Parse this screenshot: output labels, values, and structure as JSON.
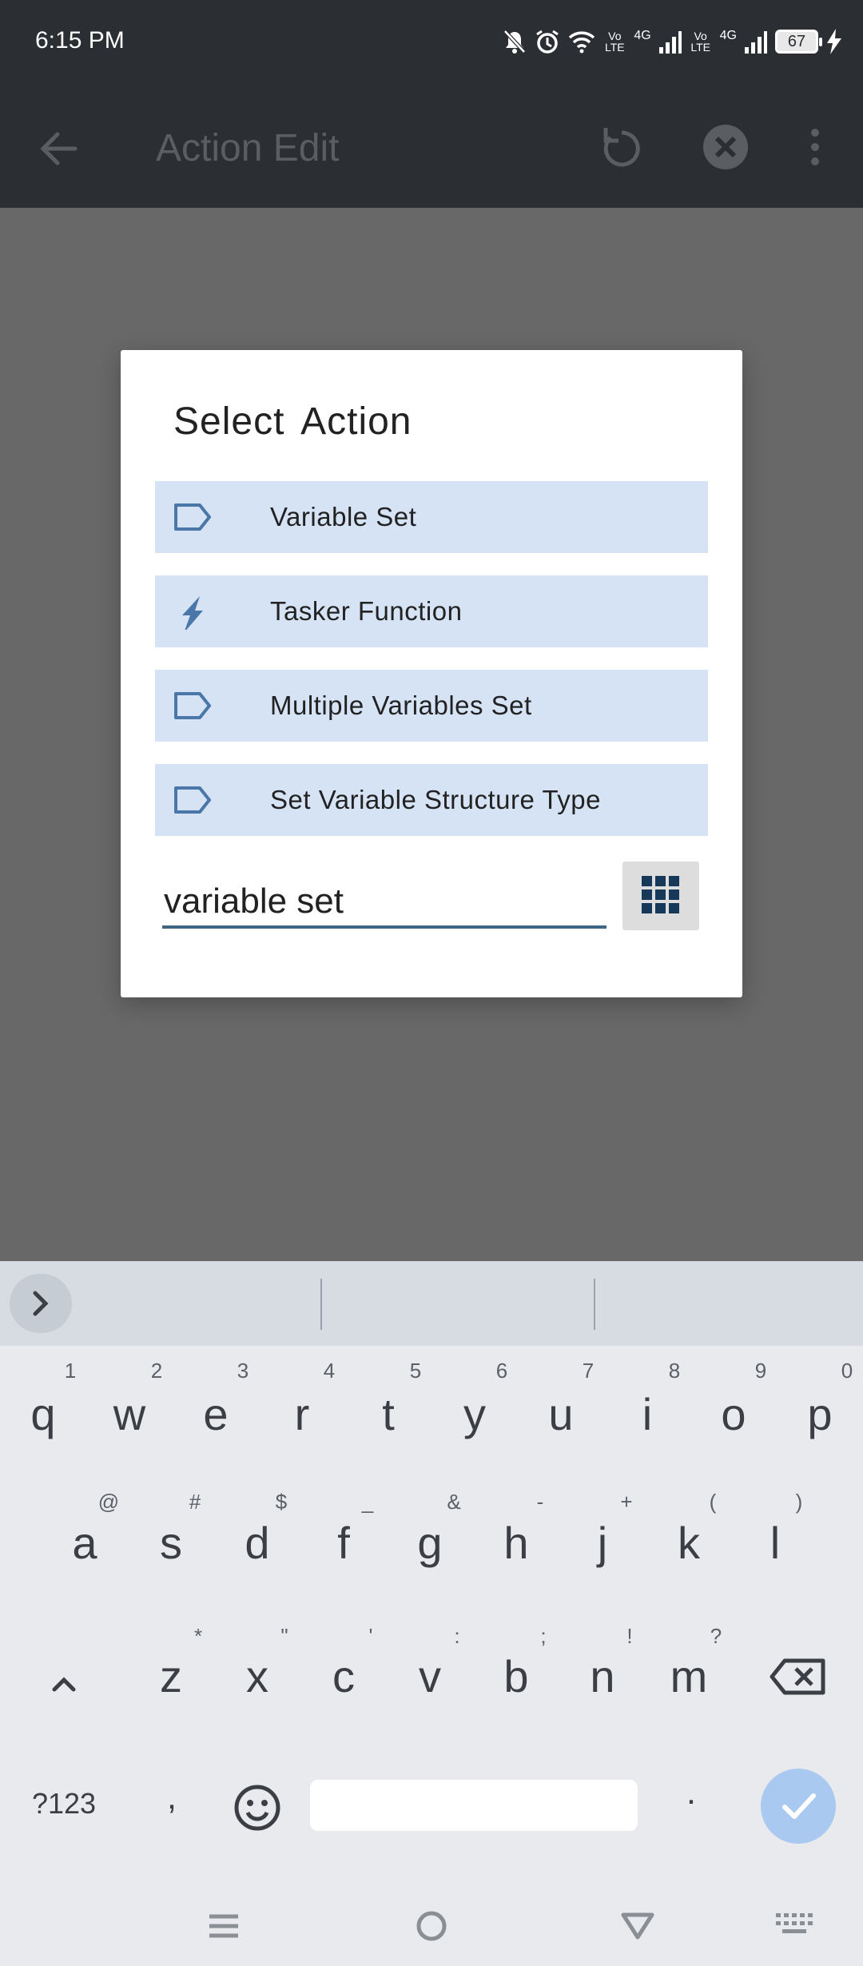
{
  "status_bar": {
    "time": "6:15 PM",
    "battery": "67",
    "net1": "Vo\nLTE",
    "net_4g1": "4G",
    "net_4g2": "4G"
  },
  "app_bar": {
    "title": "Action Edit"
  },
  "dialog": {
    "title": "Select  Action",
    "items": [
      {
        "label": "Variable Set",
        "icon": "tag-outline-icon"
      },
      {
        "label": "Tasker Function",
        "icon": "lightning-bolt-icon"
      },
      {
        "label": "Multiple Variables Set",
        "icon": "tag-outline-icon"
      },
      {
        "label": "Set Variable Structure Type",
        "icon": "tag-outline-icon"
      }
    ],
    "search_value": "variable set"
  },
  "keyboard": {
    "row1": [
      {
        "k": "q",
        "h": "1"
      },
      {
        "k": "w",
        "h": "2"
      },
      {
        "k": "e",
        "h": "3"
      },
      {
        "k": "r",
        "h": "4"
      },
      {
        "k": "t",
        "h": "5"
      },
      {
        "k": "y",
        "h": "6"
      },
      {
        "k": "u",
        "h": "7"
      },
      {
        "k": "i",
        "h": "8"
      },
      {
        "k": "o",
        "h": "9"
      },
      {
        "k": "p",
        "h": "0"
      }
    ],
    "row2": [
      {
        "k": "a",
        "h": "@"
      },
      {
        "k": "s",
        "h": "#"
      },
      {
        "k": "d",
        "h": "$"
      },
      {
        "k": "f",
        "h": "_"
      },
      {
        "k": "g",
        "h": "&"
      },
      {
        "k": "h",
        "h": "-"
      },
      {
        "k": "j",
        "h": "+"
      },
      {
        "k": "k",
        "h": "("
      },
      {
        "k": "l",
        "h": ")"
      }
    ],
    "row3": [
      {
        "k": "z",
        "h": "*"
      },
      {
        "k": "x",
        "h": "\""
      },
      {
        "k": "c",
        "h": "'"
      },
      {
        "k": "v",
        "h": ":"
      },
      {
        "k": "b",
        "h": ";"
      },
      {
        "k": "n",
        "h": "!"
      },
      {
        "k": "m",
        "h": "?"
      }
    ],
    "symbols_label": "?123",
    "comma_label": ",",
    "period_label": "."
  }
}
